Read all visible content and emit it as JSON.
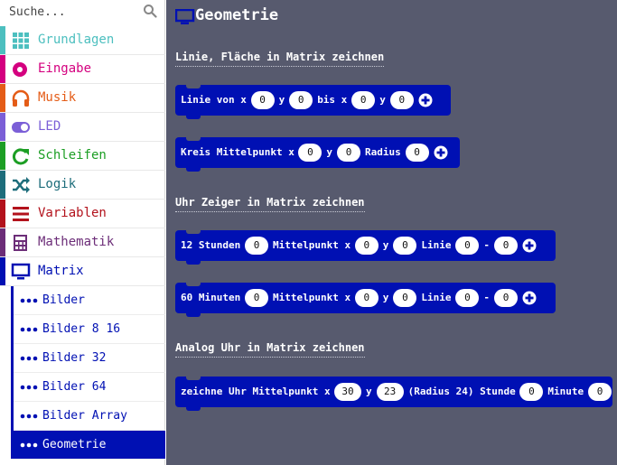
{
  "search": {
    "placeholder": "Suche...",
    "icon": "search-icon"
  },
  "categories": [
    {
      "label": "Grundlagen",
      "color": "#4cbfbf",
      "icon": "grid-icon"
    },
    {
      "label": "Eingabe",
      "color": "#d4007f",
      "icon": "target-icon"
    },
    {
      "label": "Musik",
      "color": "#e45c17",
      "icon": "headphones-icon"
    },
    {
      "label": "LED",
      "color": "#7b5fd7",
      "icon": "toggle-icon"
    },
    {
      "label": "Schleifen",
      "color": "#1c9e24",
      "icon": "refresh-icon"
    },
    {
      "label": "Logik",
      "color": "#1d6d7b",
      "icon": "shuffle-icon"
    },
    {
      "label": "Variablen",
      "color": "#b3121c",
      "icon": "list-icon"
    },
    {
      "label": "Mathematik",
      "color": "#6c2d78",
      "icon": "calculator-icon"
    },
    {
      "label": "Matrix",
      "color": "#0010b3",
      "icon": "monitor-icon"
    }
  ],
  "subcategories": [
    {
      "label": "Bilder",
      "active": false
    },
    {
      "label": "Bilder 8 16",
      "active": false
    },
    {
      "label": "Bilder 32",
      "active": false
    },
    {
      "label": "Bilder 64",
      "active": false
    },
    {
      "label": "Bilder Array",
      "active": false
    },
    {
      "label": "Geometrie",
      "active": true
    }
  ],
  "workspace": {
    "title": "Geometrie",
    "title_icon": "monitor-icon",
    "block_color": "#0010b3",
    "background": "#575a6e",
    "sections": [
      "Linie, Fläche in Matrix zeichnen",
      "Uhr Zeiger in Matrix zeichnen",
      "Analog Uhr in Matrix zeichnen"
    ],
    "blocks": [
      {
        "items": [
          {
            "type": "text",
            "value": "Linie von x"
          },
          {
            "type": "field",
            "value": "0"
          },
          {
            "type": "text",
            "value": "y"
          },
          {
            "type": "field",
            "value": "0"
          },
          {
            "type": "text",
            "value": "bis x"
          },
          {
            "type": "field",
            "value": "0"
          },
          {
            "type": "text",
            "value": "y"
          },
          {
            "type": "field",
            "value": "0"
          },
          {
            "type": "plus"
          }
        ]
      },
      {
        "items": [
          {
            "type": "text",
            "value": "Kreis Mittelpunkt x"
          },
          {
            "type": "field",
            "value": "0"
          },
          {
            "type": "text",
            "value": "y"
          },
          {
            "type": "field",
            "value": "0"
          },
          {
            "type": "text",
            "value": "Radius"
          },
          {
            "type": "field",
            "value": "0"
          },
          {
            "type": "plus"
          }
        ]
      },
      {
        "items": [
          {
            "type": "text",
            "value": "12 Stunden"
          },
          {
            "type": "field",
            "value": "0"
          },
          {
            "type": "text",
            "value": "Mittelpunkt x"
          },
          {
            "type": "field",
            "value": "0"
          },
          {
            "type": "text",
            "value": "y"
          },
          {
            "type": "field",
            "value": "0"
          },
          {
            "type": "text",
            "value": "Linie"
          },
          {
            "type": "field",
            "value": "0"
          },
          {
            "type": "text",
            "value": "-"
          },
          {
            "type": "field",
            "value": "0"
          },
          {
            "type": "plus"
          }
        ]
      },
      {
        "items": [
          {
            "type": "text",
            "value": "60 Minuten"
          },
          {
            "type": "field",
            "value": "0"
          },
          {
            "type": "text",
            "value": "Mittelpunkt x"
          },
          {
            "type": "field",
            "value": "0"
          },
          {
            "type": "text",
            "value": "y"
          },
          {
            "type": "field",
            "value": "0"
          },
          {
            "type": "text",
            "value": "Linie"
          },
          {
            "type": "field",
            "value": "0"
          },
          {
            "type": "text",
            "value": "-"
          },
          {
            "type": "field",
            "value": "0"
          },
          {
            "type": "plus"
          }
        ]
      },
      {
        "items": [
          {
            "type": "text",
            "value": "zeichne Uhr Mittelpunkt x"
          },
          {
            "type": "field",
            "value": "30"
          },
          {
            "type": "text",
            "value": "y"
          },
          {
            "type": "field",
            "value": "23"
          },
          {
            "type": "text",
            "value": "(Radius 24) Stunde"
          },
          {
            "type": "field",
            "value": "0"
          },
          {
            "type": "text",
            "value": "Minute"
          },
          {
            "type": "field",
            "value": "0"
          }
        ]
      }
    ]
  }
}
